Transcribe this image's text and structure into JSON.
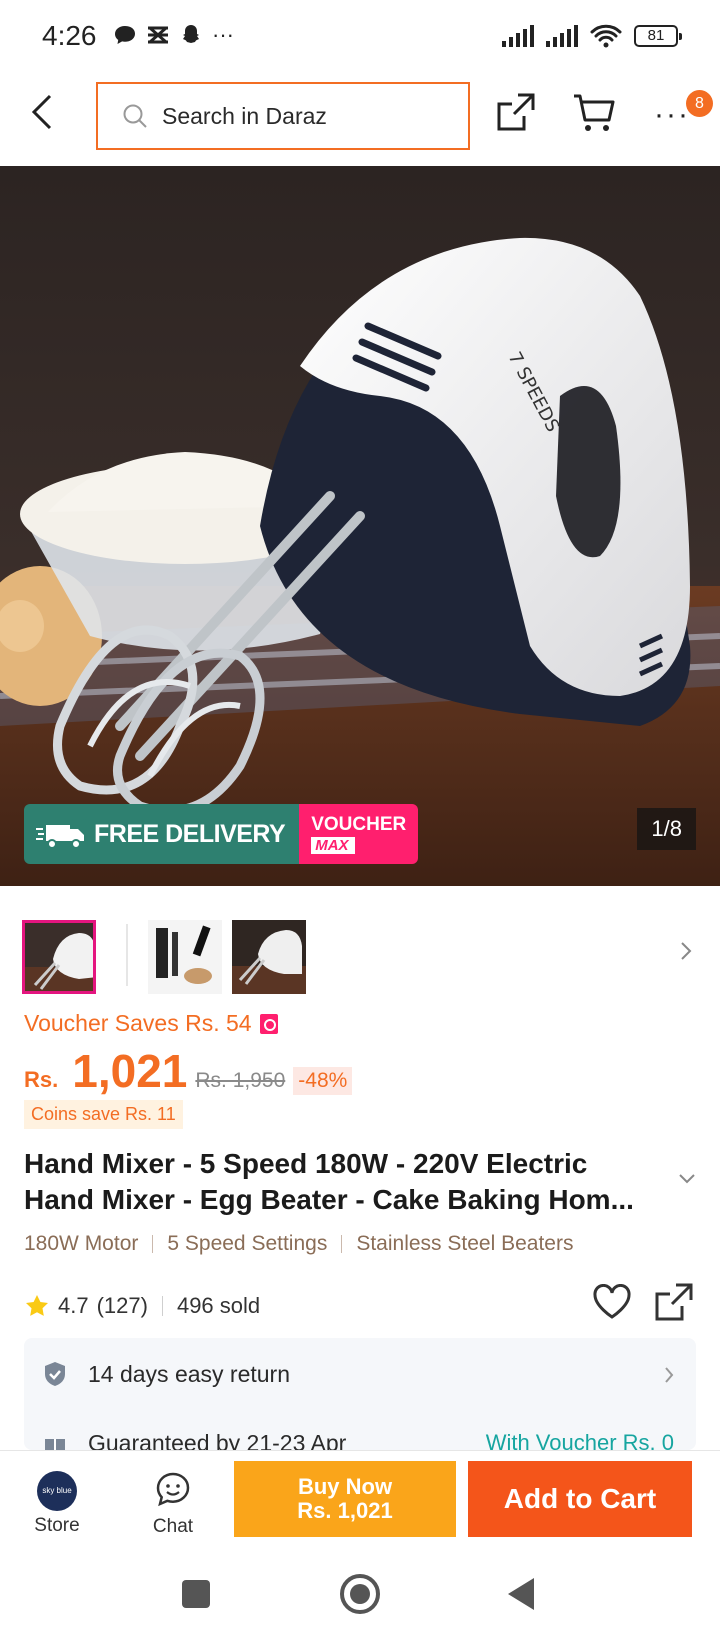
{
  "status_bar": {
    "time": "4:26",
    "battery": "81",
    "notification_icons": [
      "chat-bubble-icon",
      "app-x-icon",
      "snapchat-icon"
    ],
    "more_notifications": "···"
  },
  "header": {
    "search_placeholder": "Search in Daraz",
    "cart_badge": "8",
    "more_label": "···"
  },
  "hero": {
    "counter": "1/8",
    "free_tag": "FREE",
    "free_delivery": "FREE DELIVERY",
    "voucher_line1": "VOUCHER",
    "voucher_line2": "MAX",
    "mixer_text": "7 SPEEDS"
  },
  "product": {
    "voucher_saves": "Voucher Saves Rs. 54",
    "currency": "Rs.",
    "price": "1,021",
    "original_price": "Rs. 1,950",
    "discount": "-48%",
    "coins_save": "Coins save Rs. 11",
    "title": "Hand Mixer - 5 Speed 180W - 220V Electric Hand Mixer - Egg Beater - Cake Baking Hom...",
    "features": [
      "180W Motor",
      "5 Speed Settings",
      "Stainless Steel Beaters"
    ],
    "rating": "4.7",
    "reviews": "(127)",
    "sold": "496 sold"
  },
  "services": {
    "return_text": "14 days easy return",
    "guarantee_text": "Guaranteed by 21-23 Apr",
    "voucher_text": "With Voucher Rs. 0"
  },
  "bottom_bar": {
    "store_label": "Store",
    "store_logo_text": "sky blue",
    "chat_label": "Chat",
    "buy_now_line1": "Buy Now",
    "buy_now_line2": "Rs. 1,021",
    "add_to_cart": "Add to Cart"
  },
  "colors": {
    "brand_orange": "#f36d23",
    "buy_now": "#faa51a",
    "add_to_cart": "#f4551a",
    "voucher_pink": "#ff1f6e",
    "free_delivery_green": "#2e8070",
    "teal_text": "#16a5a0"
  }
}
